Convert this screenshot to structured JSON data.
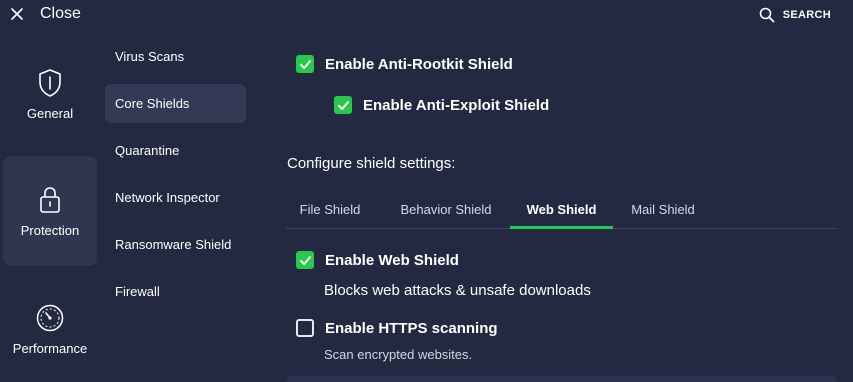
{
  "header": {
    "close_label": "Close",
    "search_label": "SEARCH"
  },
  "categories": [
    {
      "label": "General",
      "icon": "shield-icon"
    },
    {
      "label": "Protection",
      "icon": "lock-icon",
      "active": true
    },
    {
      "label": "Performance",
      "icon": "speedometer-icon"
    }
  ],
  "subnav": [
    {
      "label": "Virus Scans"
    },
    {
      "label": "Core Shields",
      "active": true
    },
    {
      "label": "Quarantine"
    },
    {
      "label": "Network Inspector"
    },
    {
      "label": "Ransomware Shield"
    },
    {
      "label": "Firewall"
    }
  ],
  "options": {
    "anti_rootkit": {
      "label": "Enable Anti-Rootkit Shield",
      "checked": true
    },
    "anti_exploit": {
      "label": "Enable Anti-Exploit Shield",
      "checked": true
    }
  },
  "configure_title": "Configure shield settings:",
  "tabs": [
    {
      "label": "File Shield"
    },
    {
      "label": "Behavior Shield"
    },
    {
      "label": "Web Shield",
      "active": true
    },
    {
      "label": "Mail Shield"
    }
  ],
  "web_shield": {
    "enable_label": "Enable Web Shield",
    "enable_checked": true,
    "enable_desc": "Blocks web attacks & unsafe downloads",
    "https_label": "Enable HTTPS scanning",
    "https_checked": false,
    "https_desc": "Scan encrypted websites."
  },
  "colors": {
    "background": "#232941",
    "accent_green": "#28c84a",
    "active_panel": "#2f3650"
  }
}
